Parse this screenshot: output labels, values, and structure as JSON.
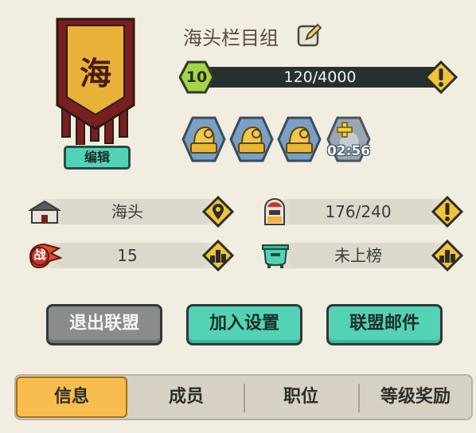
{
  "alliance": {
    "banner_char": "海",
    "edit_label": "编辑",
    "name": "海头栏目组"
  },
  "level": {
    "value": "10",
    "exp_text": "120/4000",
    "progress": 0.03
  },
  "members": {
    "slots": 3,
    "timer": "02:56"
  },
  "stats": {
    "leader": "海头",
    "members_count": "176/240",
    "power": "15",
    "ranking": "未上榜"
  },
  "buttons": {
    "quit": "退出联盟",
    "join_settings": "加入设置",
    "mail": "联盟邮件"
  },
  "tabs": {
    "info": "信息",
    "members": "成员",
    "position": "职位",
    "rewards": "等级奖励"
  },
  "icons": {
    "power_glyph": "战",
    "warn_glyph": "!"
  },
  "colors": {
    "teal": "#54d2b6",
    "banner_gold": "#e8b23a",
    "banner_red": "#7a1f1f",
    "tab_active": "#f7bd4f"
  }
}
